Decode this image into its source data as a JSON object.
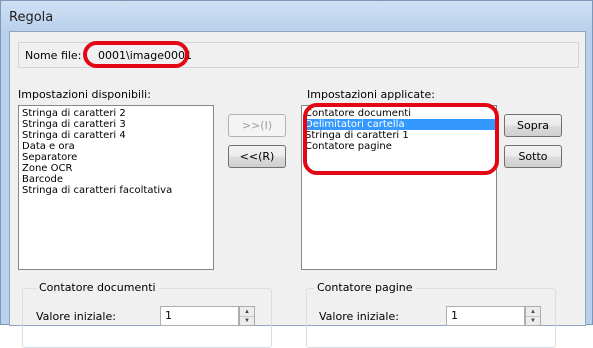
{
  "window": {
    "title": "Regola"
  },
  "file": {
    "label": "Nome file:",
    "value": "0001\\image0001"
  },
  "available": {
    "label": "Impostazioni disponibili:",
    "items": [
      "Stringa di caratteri 2",
      "Stringa di caratteri 3",
      "Stringa di caratteri 4",
      "Data e ora",
      "Separatore",
      "Zone OCR",
      "Barcode",
      "Stringa di caratteri facoltativa"
    ]
  },
  "applied": {
    "label": "Impostazioni applicate:",
    "items": [
      "Contatore documenti",
      "Delimitatori cartella",
      "Stringa di caratteri 1",
      "Contatore pagine"
    ],
    "selected_index": 1
  },
  "buttons": {
    "add": ">>(I)",
    "remove": "<<(R)",
    "up": "Sopra",
    "down": "Sotto"
  },
  "doc_counter": {
    "title": "Contatore documenti",
    "start_label": "Valore iniziale:",
    "start_value": "1"
  },
  "page_counter": {
    "title": "Contatore pagine",
    "start_label": "Valore iniziale:",
    "start_value": "1"
  },
  "colors": {
    "highlight": "#e30613",
    "selection": "#3399ff"
  },
  "icons": {
    "spin_up": "triangle-up-icon",
    "spin_down": "triangle-down-icon"
  }
}
